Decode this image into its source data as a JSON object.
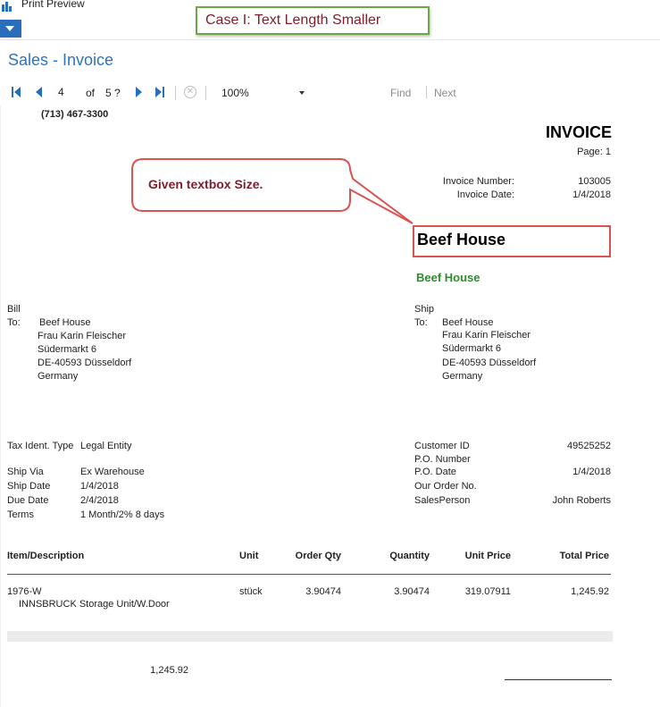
{
  "window": {
    "title": "Print Preview"
  },
  "annotation": {
    "case_label": "Case I: Text Length Smaller",
    "callout": "Given textbox Size."
  },
  "page": {
    "title": "Sales - Invoice"
  },
  "toolbar": {
    "page_current": "4",
    "page_of": "of",
    "page_total": "5 ?",
    "zoom": "100%",
    "find": "Find",
    "next": "Next"
  },
  "report": {
    "phone": "(713) 467-3300",
    "heading": "INVOICE",
    "page_label": "Page: 1",
    "invoice_number_label": "Invoice Number:",
    "invoice_number": "103005",
    "invoice_date_label": "Invoice Date:",
    "invoice_date": "1/4/2018",
    "company_big": "Beef House",
    "company_green": "Beef House",
    "bill": {
      "label1": "Bill",
      "label2": "To:",
      "lines": [
        "Beef House",
        "Frau Karin Fleischer",
        "Südermarkt 6",
        "DE-40593 Düsseldorf",
        "Germany"
      ]
    },
    "ship": {
      "label1": "Ship",
      "label2": "To:",
      "lines": [
        "Beef House",
        "Frau Karin Fleischer",
        "Südermarkt 6",
        "DE-40593 Düsseldorf",
        "Germany"
      ]
    },
    "left_fields": [
      {
        "label": "Tax Ident. Type",
        "value": "Legal Entity"
      },
      {
        "label": "Ship Via",
        "value": "Ex Warehouse"
      },
      {
        "label": "Ship Date",
        "value": "1/4/2018"
      },
      {
        "label": "Due Date",
        "value": "2/4/2018"
      },
      {
        "label": "Terms",
        "value": "1 Month/2% 8 days"
      }
    ],
    "right_fields": [
      {
        "label": "Customer ID",
        "value": "49525252"
      },
      {
        "label": "P.O. Number",
        "value": ""
      },
      {
        "label": "P.O. Date",
        "value": "1/4/2018"
      },
      {
        "label": "Our Order No.",
        "value": ""
      },
      {
        "label": "SalesPerson",
        "value": "John Roberts"
      }
    ],
    "columns": [
      "Item/Description",
      "Unit",
      "Order Qty",
      "Quantity",
      "Unit Price",
      "Total Price"
    ],
    "line_item": {
      "item": "1976-W",
      "description": "INNSBRUCK Storage Unit/W.Door",
      "unit": "stück",
      "order_qty": "3.90474",
      "quantity": "3.90474",
      "unit_price": "319.07911",
      "total_price": "1,245.92"
    },
    "subtotal": "1,245.92"
  },
  "colors": {
    "accent_blue": "#2f73b8",
    "annotation_red": "#d9534f",
    "annotation_text": "#7a1f2b",
    "case_border_green": "#6aaa3c",
    "company_green": "#2e8b2e"
  }
}
